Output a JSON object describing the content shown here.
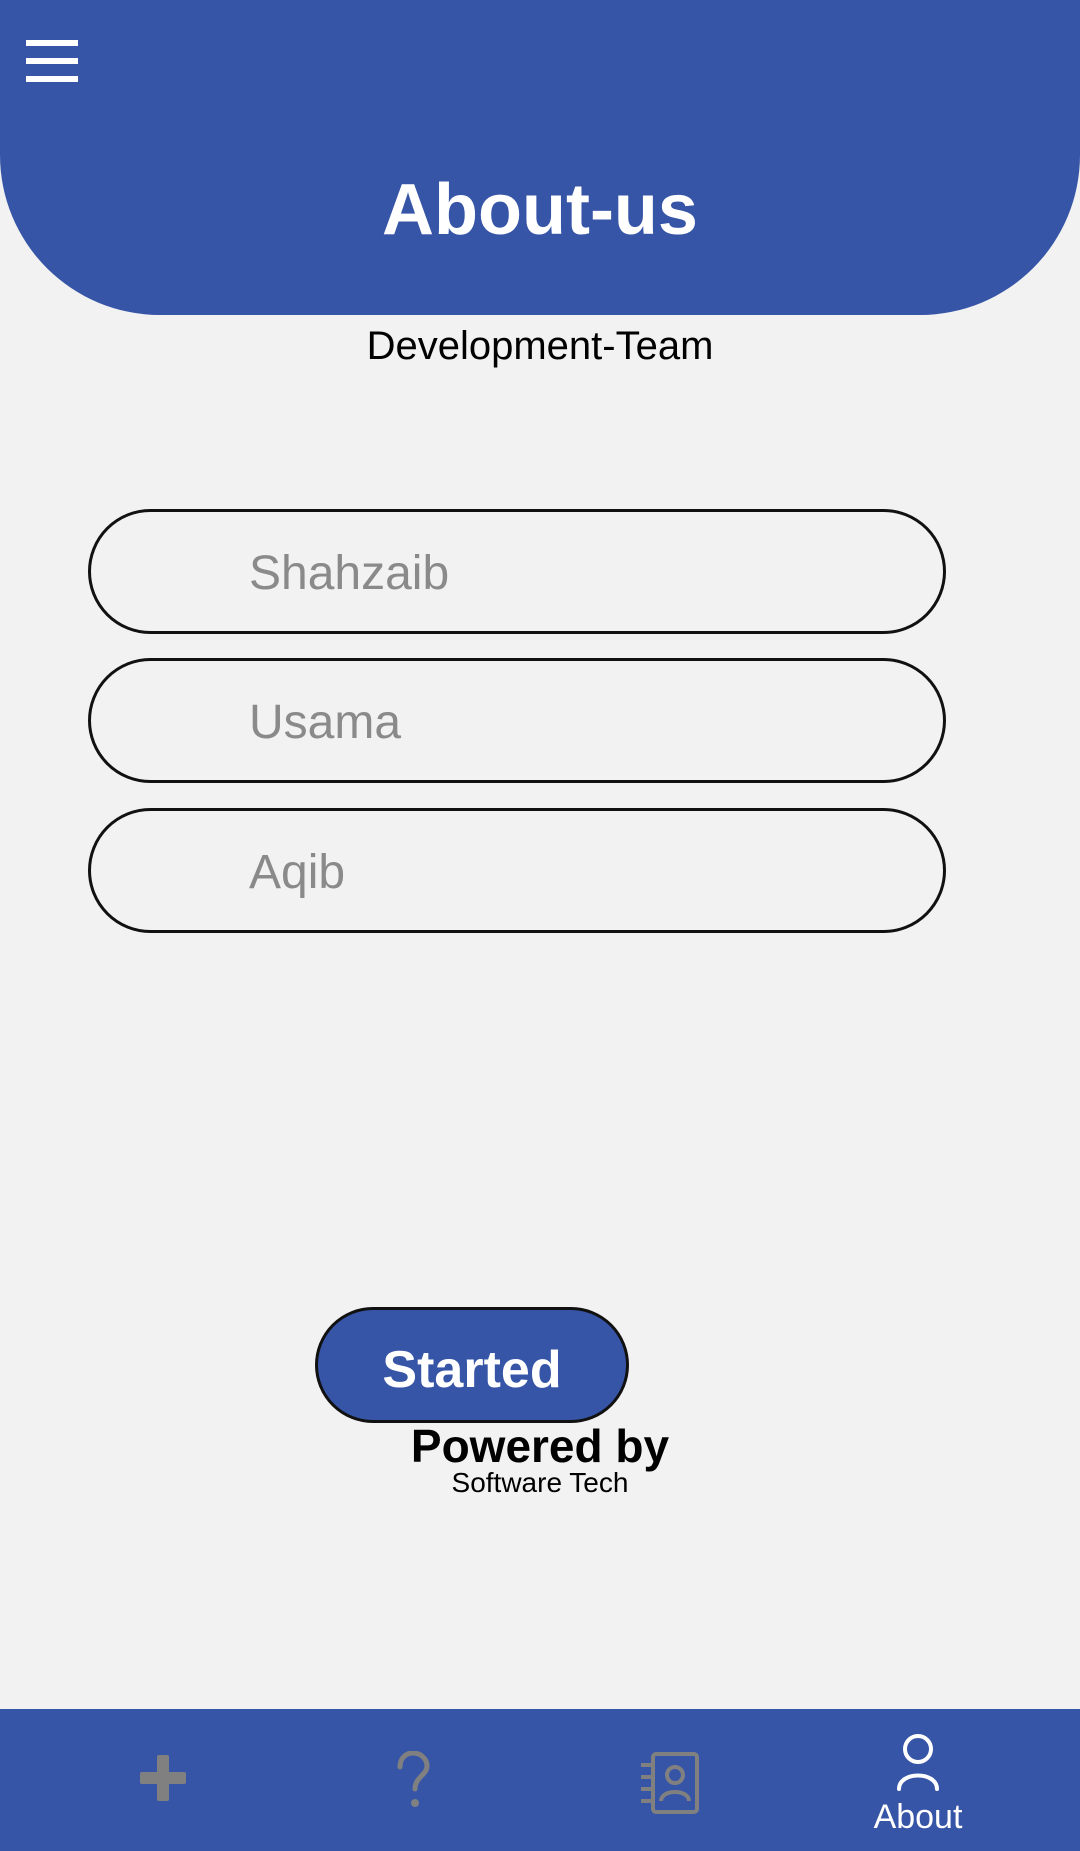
{
  "header": {
    "title": "About-us"
  },
  "section": {
    "subtitle": "Development-Team"
  },
  "team": {
    "members": [
      {
        "name": "Shahzaib"
      },
      {
        "name": "Usama"
      },
      {
        "name": "Aqib"
      }
    ]
  },
  "actions": {
    "start_label": "Started"
  },
  "footer": {
    "powered_by": "Powered by",
    "brand": "Software Tech"
  },
  "bottom_nav": {
    "items": [
      {
        "icon": "plus-icon",
        "label": "",
        "active": false
      },
      {
        "icon": "question-icon",
        "label": "",
        "active": false
      },
      {
        "icon": "contacts-icon",
        "label": "",
        "active": false
      },
      {
        "icon": "person-icon",
        "label": "About",
        "active": true
      }
    ]
  },
  "colors": {
    "primary": "#3755a7",
    "background": "#f2f2f2",
    "muted_icon": "#808080",
    "placeholder": "#8a8a8a"
  }
}
